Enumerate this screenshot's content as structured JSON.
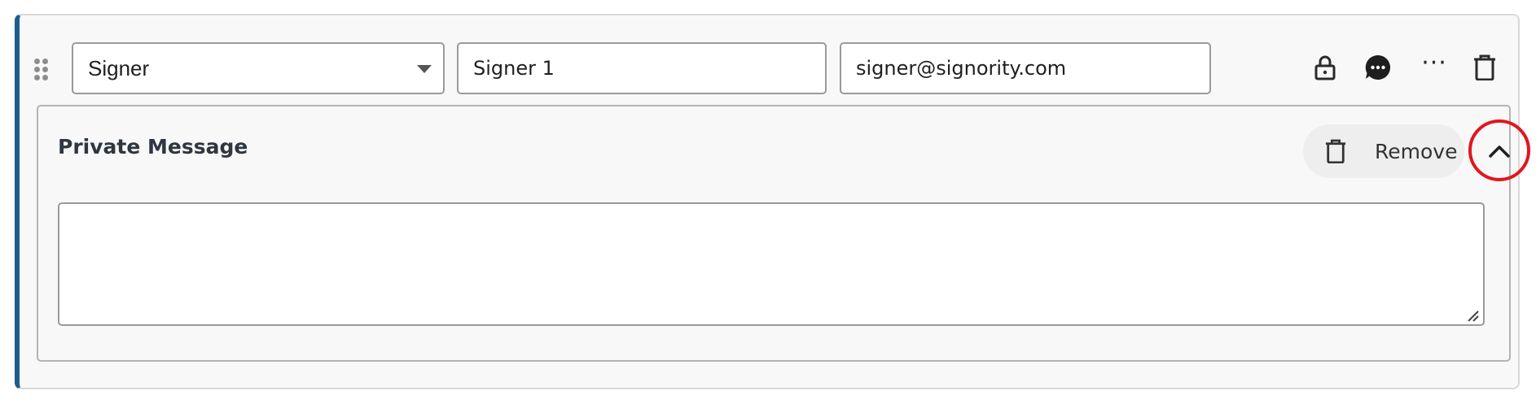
{
  "signer_row": {
    "role_select": {
      "value": "Signer",
      "options": [
        "Signer"
      ]
    },
    "name_input": {
      "value": "Signer 1"
    },
    "email_input": {
      "value": "signer@signority.com"
    },
    "actions": [
      {
        "icon": "lock-icon"
      },
      {
        "icon": "comment-icon"
      },
      {
        "icon": "more-icon",
        "glyph": "···"
      },
      {
        "icon": "trash-icon"
      }
    ]
  },
  "private_message": {
    "title": "Private Message",
    "remove_label": "Remove",
    "message_value": ""
  },
  "colors": {
    "accent_border": "#1b5e8f",
    "highlight_ring": "#e0171f",
    "card_background": "#f8f8f8"
  }
}
